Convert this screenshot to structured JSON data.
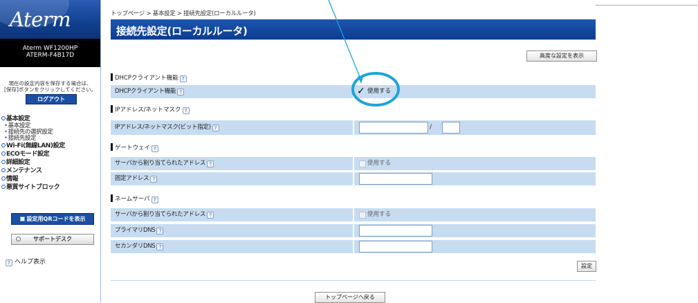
{
  "sidebar": {
    "logo": "Aterm",
    "model_line1": "Aterm WF1200HP",
    "model_line2": "ATERM-F4B17D",
    "save_note_line1": "現在の設定内容を保存する場合は、",
    "save_note_line2": "[保存]ボタンをクリックしてください。",
    "logout": "ログアウト",
    "nav": {
      "basic": "基本設定",
      "basic_sub1": "基本設定",
      "basic_sub2": "接続先の選択設定",
      "basic_sub3": "接続先設定",
      "wifi": "Wi-Fi(無線LAN)設定",
      "eco": "ECOモード設定",
      "detail": "詳細設定",
      "maintenance": "メンテナンス",
      "info": "情報",
      "block": "悪質サイトブロック"
    },
    "qr_button": "設定用QRコードを表示",
    "support_button": "サポートデスク",
    "help": "ヘルプ表示"
  },
  "main": {
    "breadcrumb": "トップページ > 基本設定 > 接続先設定(ローカルルータ)",
    "title": "接続先設定(ローカルルータ)",
    "advanced_button": "高度な設定を表示",
    "dhcp": {
      "heading": "DHCPクライアント機能",
      "label": "DHCPクライアント機能",
      "checkbox_label": "使用する",
      "checked": true
    },
    "ip": {
      "heading": "IPアドレス/ネットマスク",
      "label": "IPアドレス/ネットマスク(ビット指定)",
      "ip_value": "",
      "mask_value": "",
      "separator": "/"
    },
    "gateway": {
      "heading": "ゲートウェイ",
      "auto_label": "サーバから割り当てられたアドレス",
      "auto_checkbox": "使用する",
      "fixed_label": "固定アドレス",
      "fixed_value": ""
    },
    "nameserver": {
      "heading": "ネームサーバ",
      "auto_label": "サーバから割り当てられたアドレス",
      "auto_checkbox": "使用する",
      "primary_label": "プライマリDNS",
      "primary_value": "",
      "secondary_label": "セカンダリDNS",
      "secondary_value": ""
    },
    "set_button": "設定",
    "back_button": "トップページへ戻る",
    "help_glyph": "?"
  },
  "colors": {
    "title_bar": "#1d56b0",
    "row_bg": "#c7dcf0",
    "annotation": "#1fa3dc"
  },
  "icons": {
    "help": "question-icon",
    "check": "checkmark-icon",
    "qr": "qr-code-icon"
  }
}
